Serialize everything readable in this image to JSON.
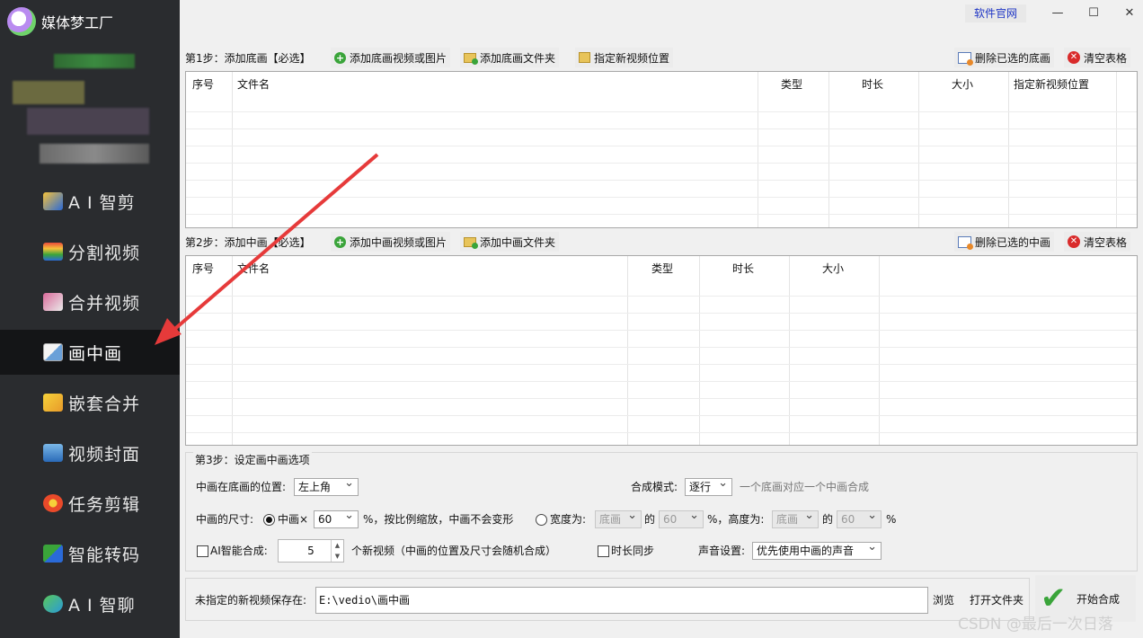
{
  "app": {
    "title": "媒体梦工厂"
  },
  "sidebar": {
    "items": [
      {
        "label": "A I 智剪",
        "icon": "ai-cut-icon"
      },
      {
        "label": "分割视频",
        "icon": "split-video-icon"
      },
      {
        "label": "合并视频",
        "icon": "merge-video-icon"
      },
      {
        "label": "画中画",
        "icon": "picture-in-picture-icon",
        "active": true
      },
      {
        "label": "嵌套合并",
        "icon": "nest-merge-icon"
      },
      {
        "label": "视频封面",
        "icon": "video-cover-icon"
      },
      {
        "label": "任务剪辑",
        "icon": "task-edit-icon"
      },
      {
        "label": "智能转码",
        "icon": "smart-transcode-icon"
      },
      {
        "label": "A I 智聊",
        "icon": "ai-chat-icon"
      }
    ]
  },
  "titlebar": {
    "official_site": "软件官网",
    "minimize": "—",
    "maximize": "☐",
    "close": "✕"
  },
  "step1": {
    "label": "第1步：添加底画【必选】",
    "add_media": "添加底画视频或图片",
    "add_folder": "添加底画文件夹",
    "set_location": "指定新视频位置",
    "delete_selected": "删除已选的底画",
    "clear_table": "清空表格",
    "columns": [
      "序号",
      "文件名",
      "类型",
      "时长",
      "大小",
      "指定新视频位置"
    ]
  },
  "step2": {
    "label": "第2步：添加中画【必选】",
    "add_media": "添加中画视频或图片",
    "add_folder": "添加中画文件夹",
    "delete_selected": "删除已选的中画",
    "clear_table": "清空表格",
    "columns": [
      "序号",
      "文件名",
      "类型",
      "时长",
      "大小"
    ]
  },
  "step3": {
    "title": "第3步：设定画中画选项",
    "position_label": "中画在底画的位置:",
    "position_value": "左上角",
    "mode_label": "合成模式:",
    "mode_value": "逐行",
    "mode_hint": "一个底画对应一个中画合成",
    "size_label": "中画的尺寸:",
    "size_option_label": "中画×",
    "size_value": "60",
    "size_hint": "%，按比例缩放，中画不会变形",
    "width_label": "宽度为:",
    "width_base": "底画",
    "width_of": "的",
    "width_value": "60",
    "height_label": "%，高度为:",
    "height_base": "底画",
    "height_of": "的",
    "height_value": "60",
    "percent": "%",
    "ai_label": "AI智能合成:",
    "ai_count": "5",
    "ai_hint": "个新视频（中画的位置及尺寸会随机合成）",
    "sync_label": "时长同步",
    "audio_label": "声音设置:",
    "audio_value": "优先使用中画的声音"
  },
  "save": {
    "label": "未指定的新视频保存在:",
    "path": "E:\\vedio\\画中画",
    "browse": "浏览",
    "open_folder": "打开文件夹"
  },
  "start_button": "开始合成",
  "watermark": "CSDN @最后一次日落",
  "colors": {
    "sidebar_bg": "#2a2c2f",
    "active_bg": "#141517",
    "arrow": "#e63a3a",
    "accent_link": "#1e35c5"
  }
}
